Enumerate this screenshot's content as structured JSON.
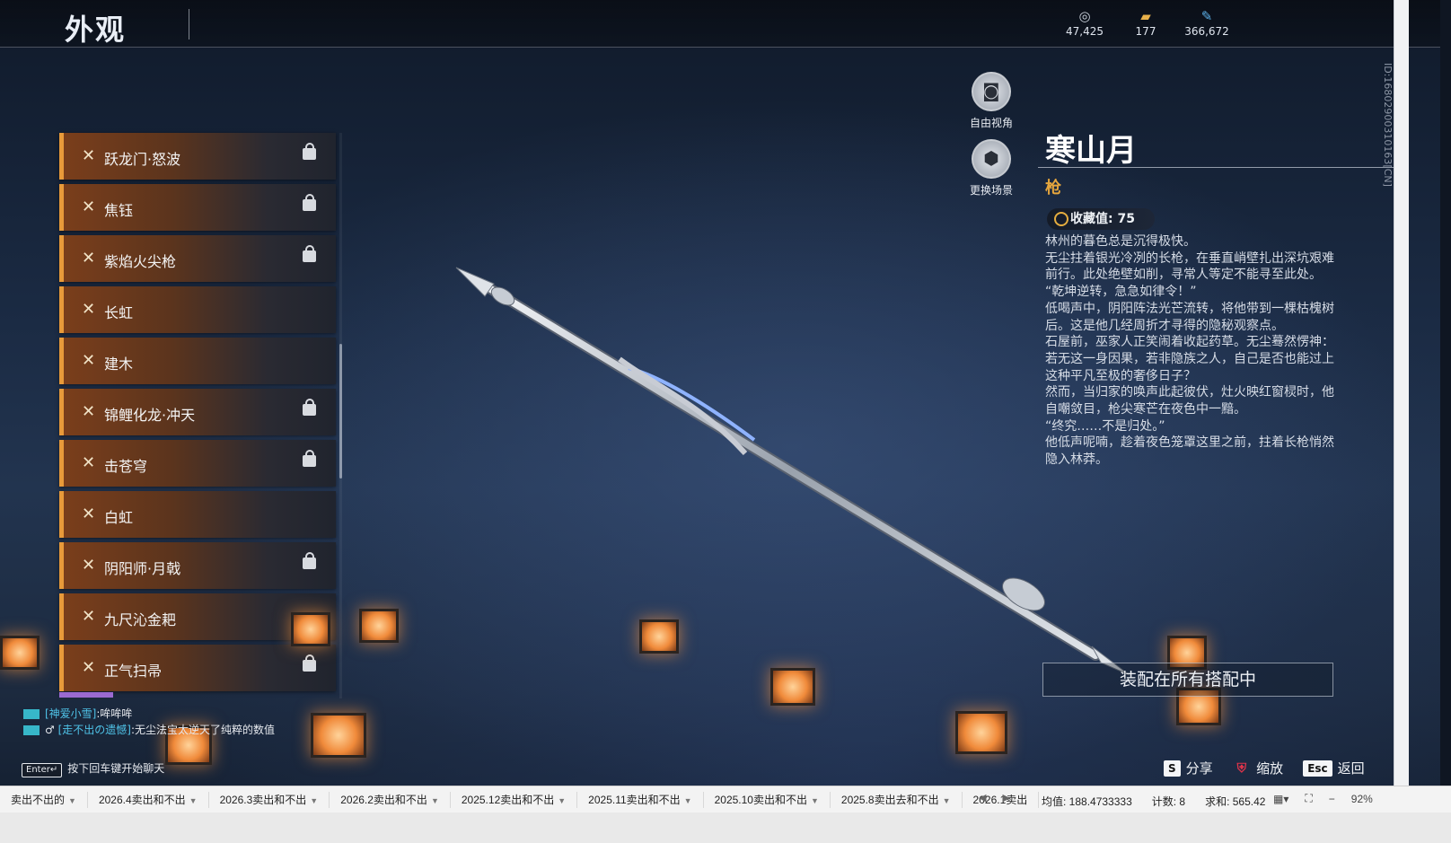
{
  "header": {
    "title": "外观"
  },
  "currencies": [
    {
      "icon": "silver-coin-icon",
      "glyph": "◎",
      "value": "47,425"
    },
    {
      "icon": "gold-ticket-icon",
      "glyph": "▰",
      "value": "177"
    },
    {
      "icon": "feather-icon",
      "glyph": "✎",
      "value": "366,672"
    }
  ],
  "skins": [
    {
      "label": "跃龙门·怒波",
      "locked": true
    },
    {
      "label": "焦钰",
      "locked": true
    },
    {
      "label": "紫焰火尖枪",
      "locked": true
    },
    {
      "label": "长虹",
      "locked": false
    },
    {
      "label": "建木",
      "locked": false
    },
    {
      "label": "锦鲤化龙·冲天",
      "locked": true
    },
    {
      "label": "击苍穹",
      "locked": true
    },
    {
      "label": "白虹",
      "locked": false
    },
    {
      "label": "阴阳师·月戟",
      "locked": true
    },
    {
      "label": "九尺沁金耙",
      "locked": false
    },
    {
      "label": "正气扫帚",
      "locked": true
    }
  ],
  "camera": {
    "free_view_label": "自由视角",
    "change_scene_label": "更换场景"
  },
  "item": {
    "name": "寒山月",
    "type": "枪",
    "collection": "收藏值: 75",
    "description": [
      "林州的暮色总是沉得极快。",
      "无尘拄着银光冷冽的长枪，在垂直峭壁扎出深坑艰难前行。此处绝壁如削，寻常人等定不能寻至此处。",
      "“乾坤逆转，急急如律令！”",
      "低喝声中，阴阳阵法光芒流转，将他带到一棵枯槐树后。这是他几经周折才寻得的隐秘观察点。",
      "石屋前，巫家人正笑闹着收起药草。无尘蓦然愣神：若无这一身因果，若非隐族之人，自己是否也能过上这种平凡至极的奢侈日子？",
      "然而，当归家的唤声此起彼伏，灶火映红窗棂时，他自嘲敛目，枪尖寒芒在夜色中一黯。",
      "“终究……不是归处。”",
      "他低声呢喃，趁着夜色笼罩这里之前，拄着长枪悄然隐入林莽。"
    ],
    "equipped_label": "装配在所有搭配中"
  },
  "side_id": "ID:1680290031016​3[CN]",
  "chat": {
    "line1_who": "[神爱小雪]",
    "line1_text": ":哞哞哞",
    "line2_who": "[走不出の遗憾]",
    "line2_text": ":无尘法宝太逆天了纯粹的数值",
    "enter_key": "Enter↵",
    "hint": "按下回车键开始聊天"
  },
  "actions": {
    "share_key": "S",
    "share_label": "分享",
    "zoom_key": "⛨",
    "zoom_label": "缩放",
    "back_key": "Esc",
    "back_label": "返回"
  },
  "statusbar": {
    "sheets": [
      "卖出不出的",
      "2026.4卖出和不出",
      "2026.3卖出和不出",
      "2026.2卖出和不出",
      "2025.12卖出和不出",
      "2025.11卖出和不出",
      "2025.10卖出和不出",
      "2025.8卖出去和不出",
      "2026.1卖出"
    ],
    "average": "均值: 188.4733333",
    "count": "计数: 8",
    "sum": "求和: 565.42",
    "zoom": "92%"
  },
  "colors": {
    "accent_orange": "#e89a3a",
    "type_gold": "#e6a63d",
    "chat_cyan": "#4fc3e8"
  }
}
